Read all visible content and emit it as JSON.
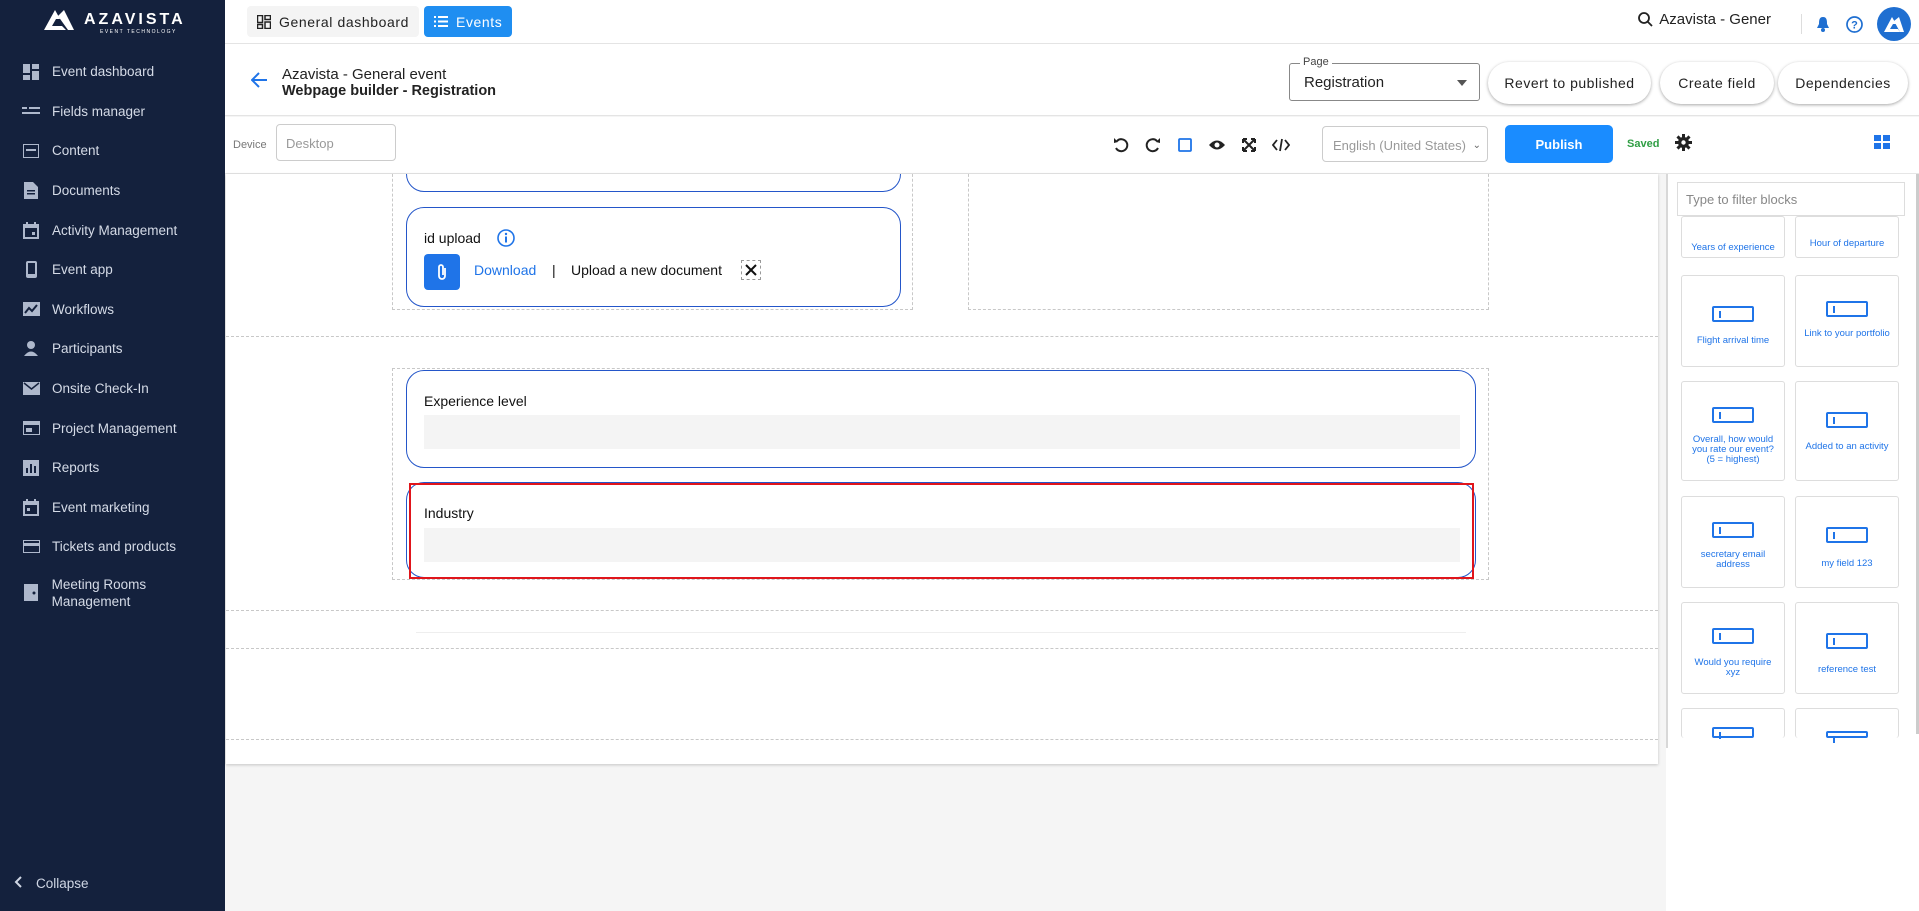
{
  "brand": {
    "name": "AZAVISTA",
    "tagline": "EVENT TECHNOLOGY"
  },
  "sidebar": {
    "items": [
      {
        "label": "Event dashboard",
        "icon": "dashboard-icon"
      },
      {
        "label": "Fields manager",
        "icon": "fields-icon"
      },
      {
        "label": "Content",
        "icon": "content-icon"
      },
      {
        "label": "Documents",
        "icon": "document-icon"
      },
      {
        "label": "Activity Management",
        "icon": "calendar-icon"
      },
      {
        "label": "Event app",
        "icon": "phone-icon"
      },
      {
        "label": "Workflows",
        "icon": "workflow-icon"
      },
      {
        "label": "Participants",
        "icon": "person-icon"
      },
      {
        "label": "Onsite Check-In",
        "icon": "mail-icon"
      },
      {
        "label": "Project Management",
        "icon": "project-icon"
      },
      {
        "label": "Reports",
        "icon": "reports-icon"
      },
      {
        "label": "Event marketing",
        "icon": "calendar-icon"
      },
      {
        "label": "Tickets and products",
        "icon": "card-icon"
      },
      {
        "label": "Meeting Rooms Management",
        "icon": "room-icon"
      }
    ],
    "collapse_label": "Collapse"
  },
  "topbar": {
    "general_dashboard": "General dashboard",
    "events": "Events",
    "search_text": "Azavista - Gener"
  },
  "header": {
    "event_title": "Azavista - General event",
    "page_title": "Webpage builder - Registration",
    "page_select_legend": "Page",
    "page_select_value": "Registration",
    "revert_label": "Revert to published",
    "create_field_label": "Create field",
    "dependencies_label": "Dependencies"
  },
  "toolbar": {
    "device_label": "Device",
    "device_value": "Desktop",
    "language_value": "English (United States)",
    "publish_label": "Publish",
    "saved_label": "Saved"
  },
  "canvas": {
    "id_upload_label": "id upload",
    "download_label": "Download",
    "separator": "|",
    "upload_label": "Upload a new document",
    "experience_label": "Experience level",
    "industry_label": "Industry"
  },
  "blocks_panel": {
    "filter_placeholder": "Type to filter blocks",
    "blocks": [
      "Years of experience",
      "Hour of departure",
      "Flight arrival time",
      "Link to your portfolio",
      "Overall, how would you rate our event? (5 = highest)",
      "Added to an activity",
      "secretary email address",
      "my field 123",
      "Would you require xyz",
      "reference test"
    ]
  },
  "colors": {
    "sidebar": "#14213d",
    "accent": "#1a8cff",
    "selection": "#e0151b",
    "saved": "#2f9e44"
  }
}
